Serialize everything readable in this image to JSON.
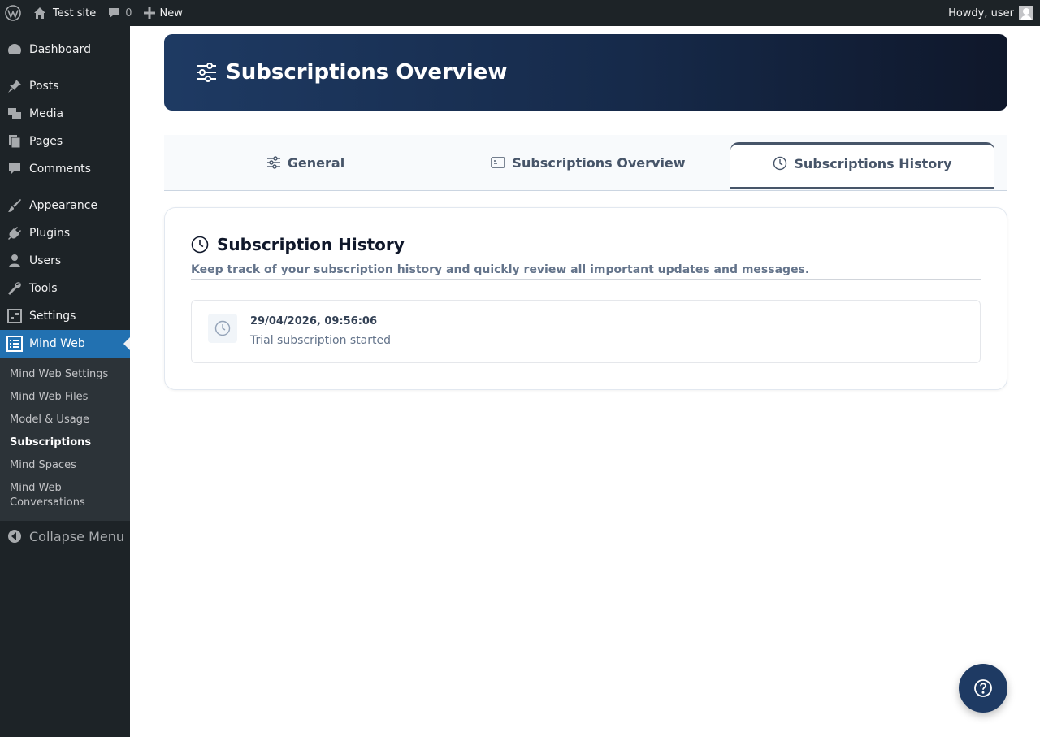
{
  "admin_bar": {
    "site_name": "Test site",
    "comments_count": "0",
    "new_label": "New",
    "greeting": "Howdy, user"
  },
  "sidebar": {
    "items": [
      {
        "label": "Dashboard",
        "icon": "dashboard-icon"
      },
      {
        "label": "Posts",
        "icon": "pin-icon"
      },
      {
        "label": "Media",
        "icon": "media-icon"
      },
      {
        "label": "Pages",
        "icon": "pages-icon"
      },
      {
        "label": "Comments",
        "icon": "comment-icon"
      },
      {
        "label": "Appearance",
        "icon": "brush-icon"
      },
      {
        "label": "Plugins",
        "icon": "plug-icon"
      },
      {
        "label": "Users",
        "icon": "user-icon"
      },
      {
        "label": "Tools",
        "icon": "wrench-icon"
      },
      {
        "label": "Settings",
        "icon": "sliders-icon"
      },
      {
        "label": "Mind Web",
        "icon": "list-icon"
      }
    ],
    "submenu": [
      "Mind Web Settings",
      "Mind Web Files",
      "Model & Usage",
      "Subscriptions",
      "Mind Spaces",
      "Mind Web Conversations"
    ],
    "collapse_label": "Collapse Menu"
  },
  "hero": {
    "title": "Subscriptions Overview"
  },
  "tabs": [
    {
      "label": "General",
      "icon": "sliders-icon"
    },
    {
      "label": "Subscriptions Overview",
      "icon": "card-icon"
    },
    {
      "label": "Subscriptions History",
      "icon": "clock-icon",
      "active": true
    }
  ],
  "history": {
    "title": "Subscription History",
    "description": "Keep track of your subscription history and quickly review all important updates and messages.",
    "entries": [
      {
        "timestamp": "29/04/2026, 09:56:06",
        "message": "Trial subscription started"
      }
    ]
  },
  "colors": {
    "accent": "#2271b1",
    "hero_start": "#1e3a63",
    "hero_end": "#0f172a"
  }
}
